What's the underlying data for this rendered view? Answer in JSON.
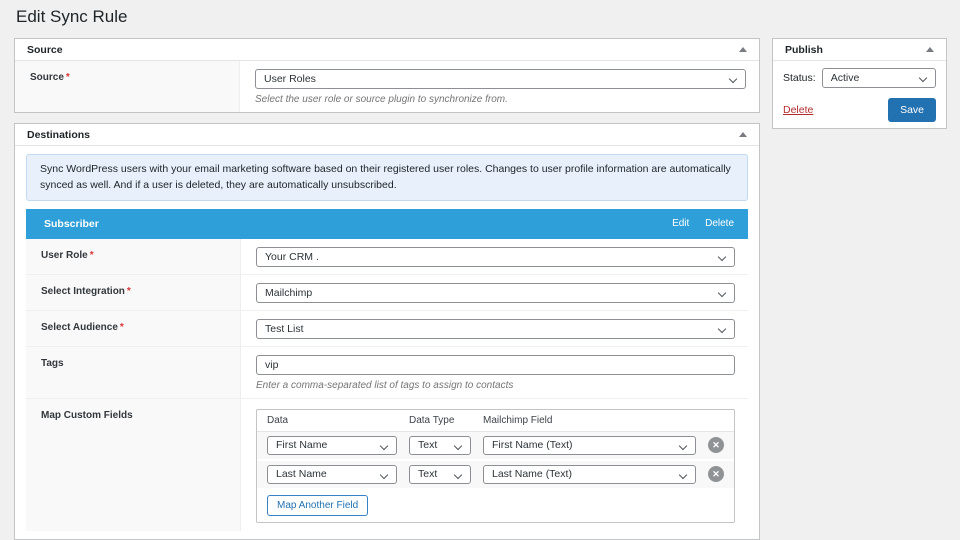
{
  "page_title": "Edit Sync Rule",
  "source": {
    "panel_title": "Source",
    "label": "Source",
    "required_mark": "*",
    "value": "User Roles",
    "helper": "Select the user role or source plugin to synchronize from."
  },
  "destinations": {
    "panel_title": "Destinations",
    "notice": "Sync WordPress users with your email marketing software based on their registered user roles. Changes to user profile information are automatically synced as well. And if a user is deleted, they are automatically unsubscribed.",
    "subscriber": {
      "title": "Subscriber",
      "edit_label": "Edit",
      "delete_label": "Delete"
    },
    "rows": {
      "user_role": {
        "label": "User Role",
        "required": "*",
        "value": "Your CRM ."
      },
      "integration": {
        "label": "Select Integration",
        "required": "*",
        "value": "Mailchimp"
      },
      "audience": {
        "label": "Select Audience",
        "required": "*",
        "value": "Test List"
      },
      "tags": {
        "label": "Tags",
        "value": "vip",
        "helper": "Enter a comma-separated list of tags to assign to contacts"
      },
      "map_fields": {
        "label": "Map Custom Fields",
        "columns": [
          "Data",
          "Data Type",
          "Mailchimp Field"
        ],
        "mappings": [
          {
            "data": "First Name",
            "data_type": "Text",
            "target_field": "First Name (Text)"
          },
          {
            "data": "Last Name",
            "data_type": "Text",
            "target_field": "Last Name (Text)"
          }
        ],
        "remove_icon": "✕",
        "add_button_label": "Map Another Field"
      }
    }
  },
  "publish": {
    "panel_title": "Publish",
    "status_label": "Status:",
    "status_value": "Active",
    "delete_label": "Delete",
    "save_label": "Save"
  },
  "colors": {
    "page_bg": "#f0f0f1",
    "panel_border": "#c3c4c7",
    "subscriber_bar_blue": "#2e9fd8",
    "accent_blue": "#2271b1",
    "delete_red": "#b32d2e",
    "notice_bg": "#e8f1fb",
    "required_red": "#d63638"
  }
}
